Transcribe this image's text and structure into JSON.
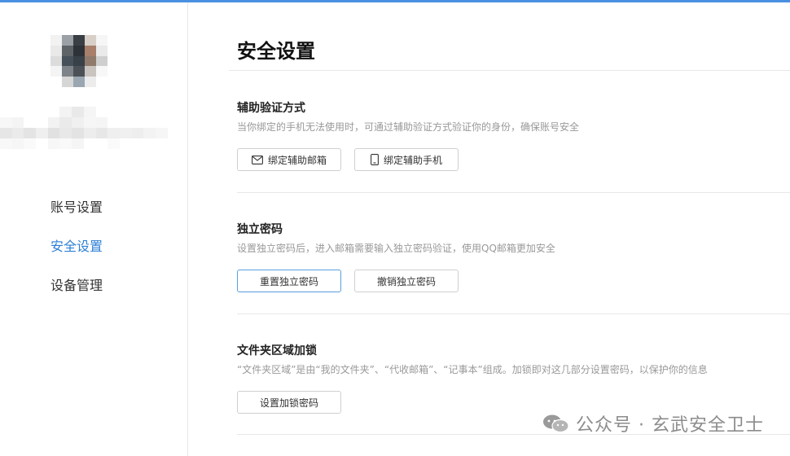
{
  "sidebar": {
    "nav": [
      {
        "label": "账号设置",
        "active": false
      },
      {
        "label": "安全设置",
        "active": true
      },
      {
        "label": "设备管理",
        "active": false
      }
    ]
  },
  "main": {
    "title": "安全设置",
    "sections": {
      "auxiliary": {
        "title": "辅助验证方式",
        "desc": "当你绑定的手机无法使用时，可通过辅助验证方式验证你的身份，确保账号安全",
        "bind_email": "绑定辅助邮箱",
        "bind_phone": "绑定辅助手机"
      },
      "independent_password": {
        "title": "独立密码",
        "desc": "设置独立密码后，进入邮箱需要输入独立密码验证，使用QQ邮箱更加安全",
        "reset": "重置独立密码",
        "revoke": "撤销独立密码"
      },
      "folder_lock": {
        "title": "文件夹区域加锁",
        "desc": "“文件夹区域”是由“我的文件夹”、“代收邮箱”、“记事本”组成。加锁即对这几部分设置密码，以保护你的信息",
        "set": "设置加锁密码"
      }
    }
  },
  "watermark": {
    "text": "公众号 · 玄武安全卫士"
  },
  "colors": {
    "accent": "#2e7fd6",
    "topbar": "#4a90e2",
    "primary_border": "#5a9ee0"
  },
  "icons": {
    "email": "mail-icon",
    "phone": "phone-icon",
    "watermark": "wechat-icon"
  }
}
